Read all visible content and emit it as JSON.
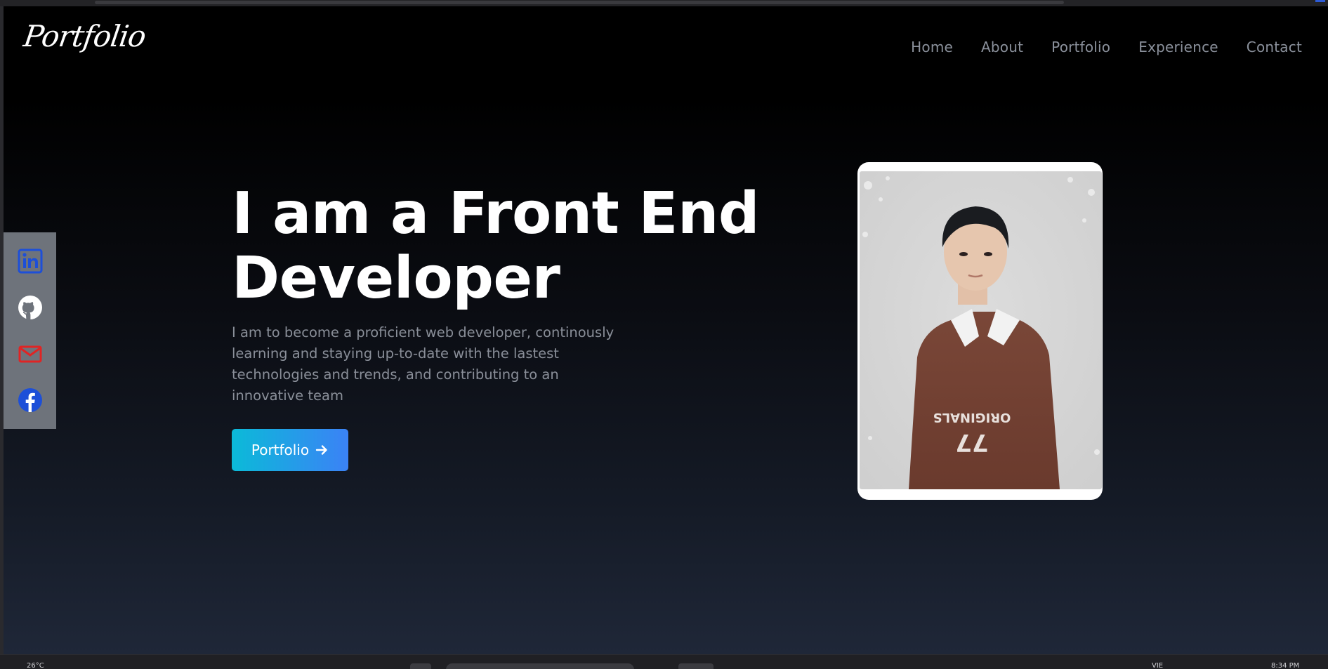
{
  "header": {
    "logo_text": "Portfolio",
    "nav": [
      {
        "label": "Home"
      },
      {
        "label": "About"
      },
      {
        "label": "Portfolio"
      },
      {
        "label": "Experience"
      },
      {
        "label": "Contact"
      }
    ]
  },
  "social": [
    {
      "icon": "linkedin-icon",
      "color": "#1d4fd8"
    },
    {
      "icon": "github-icon",
      "color": "#ffffff"
    },
    {
      "icon": "mail-icon",
      "color": "#e02424"
    },
    {
      "icon": "facebook-icon",
      "color": "#1d4fd8"
    }
  ],
  "hero": {
    "title_line1": "I am a Front End",
    "title_line2": "Developer",
    "description": "I am to become a proficient web developer, continously learning and staying up-to-date with the lastest technologies and trends, and contributing to an innovative team",
    "cta_label": "Portfolio",
    "cta_icon": "arrow-right-icon"
  },
  "profile_photo": {
    "icon": "profile-photo",
    "shirt_text": "ORIGINALS",
    "shirt_number": "77"
  },
  "taskbar": {
    "weather": "26°C",
    "lang": "VIE",
    "time": "8:34 PM"
  },
  "colors": {
    "accent_from": "#0bbad8",
    "accent_to": "#3b82f6",
    "social_panel": "#6e737b"
  }
}
